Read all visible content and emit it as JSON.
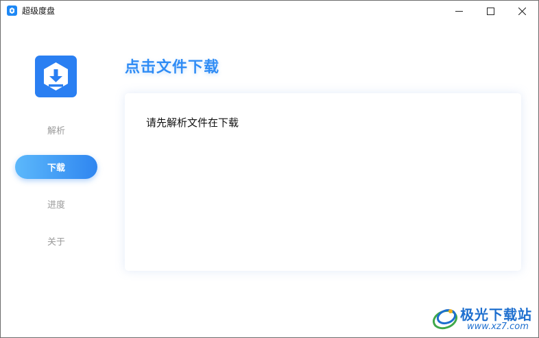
{
  "window": {
    "title": "超级度盘",
    "controls": {
      "minimize": "minimize-icon",
      "maximize": "maximize-icon",
      "close": "close-icon"
    }
  },
  "sidebar": {
    "logo_icon": "download-box-icon",
    "items": [
      {
        "label": "解析",
        "active": false
      },
      {
        "label": "下载",
        "active": true
      },
      {
        "label": "进度",
        "active": false
      },
      {
        "label": "关于",
        "active": false
      }
    ]
  },
  "main": {
    "title": "点击文件下载",
    "message": "请先解析文件在下载"
  },
  "watermark": {
    "name": "极光下载站",
    "url": "www.xz7.com"
  },
  "colors": {
    "accent": "#2f8cf5",
    "active_gradient_start": "#5cb8fb",
    "active_gradient_end": "#2f86f0",
    "logo_bg": "#2a7ff2"
  }
}
